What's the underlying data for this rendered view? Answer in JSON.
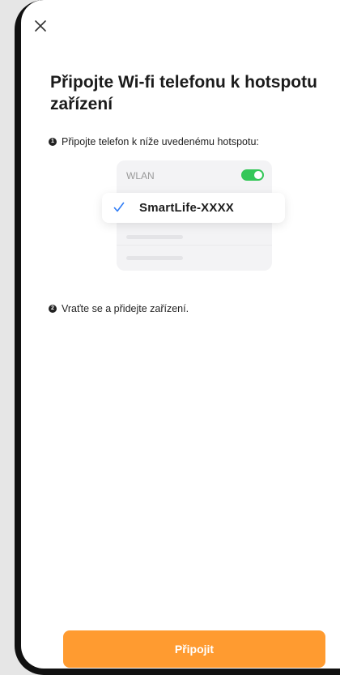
{
  "header": {
    "close_icon": "close-icon"
  },
  "title": "Připojte Wi-fi telefonu k hotspotu zařízení",
  "steps": [
    {
      "number": "1",
      "text": "Připojte telefon k níže uvedenému hotspotu:"
    },
    {
      "number": "2",
      "text": "Vraťte se a přidejte zařízení."
    }
  ],
  "illustration": {
    "wlan_label": "WLAN",
    "toggle_on": true,
    "network_name": "SmartLife-XXXX",
    "check_icon": "check-icon"
  },
  "footer": {
    "connect_label": "Připojit"
  },
  "colors": {
    "accent": "#ff9b30",
    "toggle": "#35c759",
    "check": "#2f7cf6"
  }
}
